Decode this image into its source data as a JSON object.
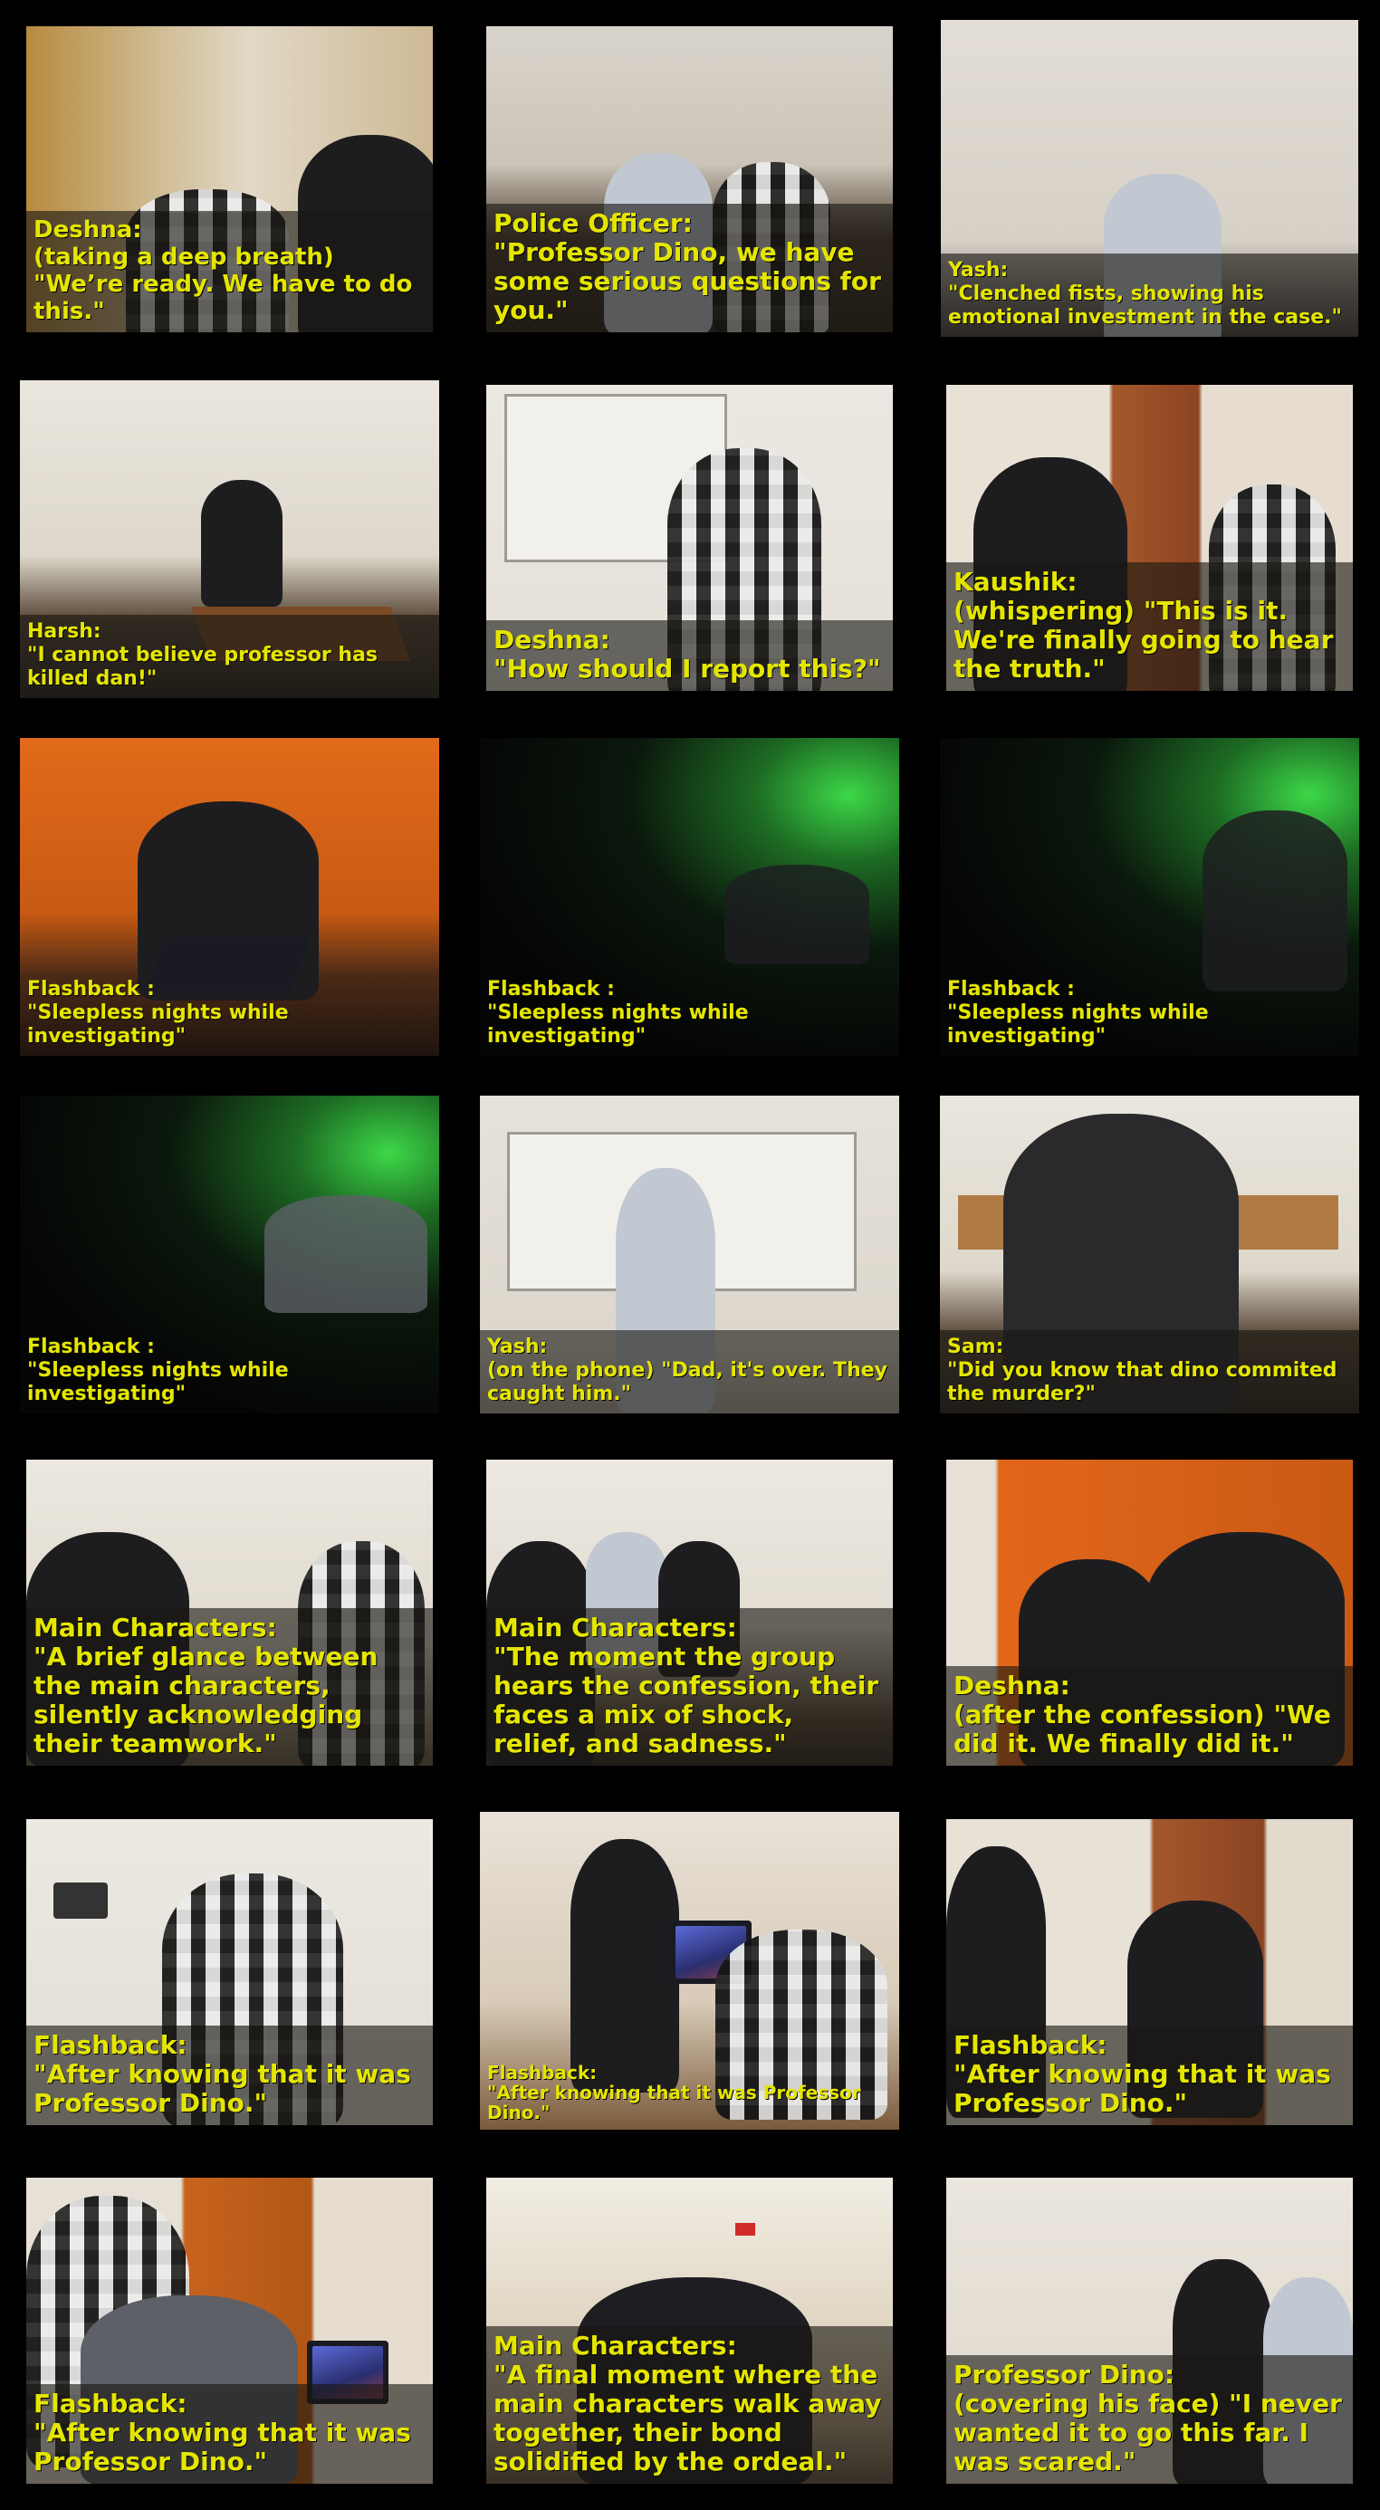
{
  "panels": [
    {
      "caption": [
        "Deshna:",
        "(taking a deep breath) \"We’re ready. We have to do this.\""
      ]
    },
    {
      "caption": [
        "Police Officer:",
        "\"Professor Dino, we have some serious questions for you.\""
      ]
    },
    {
      "caption": [
        "Yash:",
        "\"Clenched fists, showing his emotional investment in the case.\""
      ]
    },
    {
      "caption": [
        "Harsh:",
        "\"I cannot believe professor has killed dan!\""
      ]
    },
    {
      "caption": [
        "Deshna:",
        "\"How should I report this?\""
      ]
    },
    {
      "caption": [
        "Kaushik:",
        "(whispering) \"This is it. We're finally going to hear the truth.\""
      ]
    },
    {
      "caption": [
        "Flashback :",
        "\"Sleepless nights while investigating\""
      ]
    },
    {
      "caption": [
        "Flashback :",
        "\"Sleepless nights while investigating\""
      ]
    },
    {
      "caption": [
        "Flashback :",
        "\"Sleepless nights while investigating\""
      ]
    },
    {
      "caption": [
        "Flashback :",
        "\"Sleepless nights while investigating\""
      ]
    },
    {
      "caption": [
        "Yash:",
        "(on the phone) \"Dad, it's over. They caught him.\""
      ]
    },
    {
      "caption": [
        "Sam:",
        "\"Did you know that dino commited the murder?\""
      ]
    },
    {
      "caption": [
        "Main Characters:",
        "\"A brief glance between the main characters, silently acknowledging their teamwork.\""
      ]
    },
    {
      "caption": [
        "Main Characters:",
        "\"The moment the group hears the confession, their faces a mix of shock, relief, and sadness.\""
      ]
    },
    {
      "caption": [
        "Deshna:",
        "(after the confession) \"We did it. We finally did it.\""
      ]
    },
    {
      "caption": [
        "Flashback:",
        "\"After knowing that it was Professor Dino.\""
      ]
    },
    {
      "caption": [
        "Flashback:",
        "\"After knowing that it was Professor Dino.\""
      ]
    },
    {
      "caption": [
        "Flashback:",
        "\"After knowing that it was  Professor Dino.\""
      ]
    },
    {
      "caption": [
        "Flashback:",
        "\"After knowing that it was  Professor Dino.\""
      ]
    },
    {
      "caption": [
        "Main Characters:",
        "\"A final moment where the main characters walk away together, their bond solidified by the ordeal.\""
      ]
    },
    {
      "caption": [
        "Professor Dino:",
        "(covering his face) \"I never wanted it to go this far. I was scared.\""
      ]
    }
  ]
}
